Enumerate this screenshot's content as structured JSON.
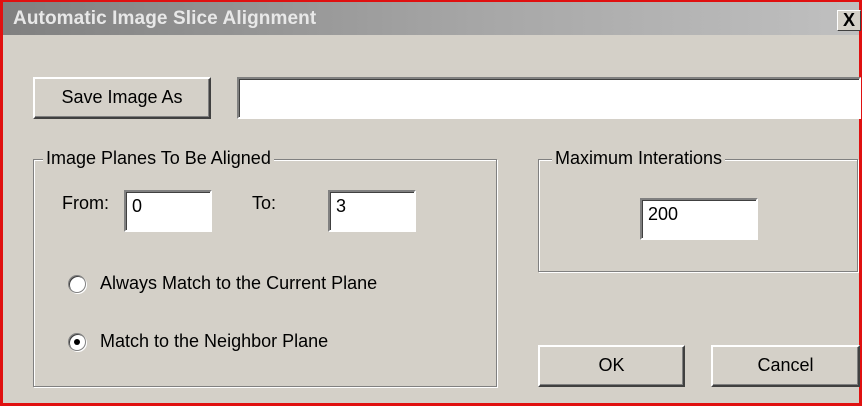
{
  "window": {
    "title": "Automatic Image Slice Alignment",
    "close_label": "X"
  },
  "save": {
    "button_label": "Save Image As",
    "path_value": ""
  },
  "planes_group": {
    "legend": "Image Planes To Be Aligned",
    "from_label": "From:",
    "from_value": "0",
    "to_label": "To:",
    "to_value": "3",
    "options": [
      {
        "label": "Always Match to the Current Plane",
        "selected": false
      },
      {
        "label": "Match to the Neighbor Plane",
        "selected": true
      }
    ]
  },
  "iterations_group": {
    "legend": "Maximum Interations",
    "value": "200"
  },
  "actions": {
    "ok_label": "OK",
    "cancel_label": "Cancel"
  }
}
